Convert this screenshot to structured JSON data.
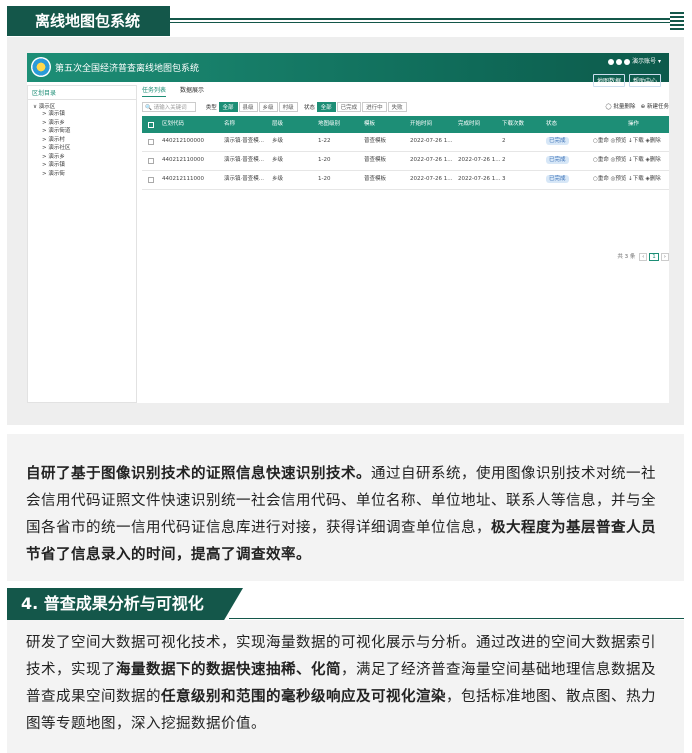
{
  "section1": {
    "title": "离线地图包系统"
  },
  "app": {
    "title": "第五次全国经济普查离线地图包系统",
    "user": "演示账号",
    "buttons": [
      "地图数据",
      "帮助中心"
    ],
    "sidebar": {
      "title": "区划目录",
      "root": "演示区",
      "items": [
        "演示镇",
        "演示乡",
        "演示街道",
        "演示村",
        "演示社区",
        "演示乡",
        "演示镇",
        "演示街"
      ]
    },
    "tabs": [
      "任务列表",
      "数据展示"
    ],
    "filters": {
      "search_placeholder": "请输入关键词",
      "type_label": "类型",
      "type_options": [
        "全部",
        "县级",
        "乡级",
        "村级"
      ],
      "status_label": "状态",
      "status_options": [
        "全部",
        "已完成",
        "进行中",
        "失败"
      ],
      "right1": "批量删除",
      "right2": "新建任务"
    },
    "table": {
      "headers": [
        "区划代码",
        "名称",
        "层级",
        "地图级别",
        "模板",
        "开始时间",
        "完成时间",
        "下载次数",
        "状态",
        "操作"
      ],
      "rows": [
        {
          "code": "440212100000",
          "name": "演示镇·普查模...",
          "level": "乡级",
          "zoom": "1-22",
          "template": "普查模板",
          "start": "2022-07-26 1...",
          "end": "",
          "count": "2",
          "status": "已完成",
          "ops": [
            "重命",
            "预览",
            "下载",
            "删除"
          ]
        },
        {
          "code": "440212110000",
          "name": "演示镇·普查模...",
          "level": "乡级",
          "zoom": "1-20",
          "template": "普查模板",
          "start": "2022-07-26 1...",
          "end": "2022-07-26 1...",
          "count": "2",
          "status": "已完成",
          "ops": [
            "重命",
            "预览",
            "下载",
            "删除"
          ]
        },
        {
          "code": "440212111000",
          "name": "演示镇·普查模...",
          "level": "乡级",
          "zoom": "1-20",
          "template": "普查模板",
          "start": "2022-07-26 1...",
          "end": "2022-07-26 1...",
          "count": "3",
          "status": "已完成",
          "ops": [
            "重命",
            "预览",
            "下载",
            "删除"
          ]
        }
      ]
    },
    "pager": {
      "total": "共 3 条",
      "page": "1"
    }
  },
  "para1": {
    "s1": "自研了基于图像识别技术的证照信息快速识别技术。",
    "s2": "通过自研系统，使用图像识别技术对统一社会信用代码证照文件快速识别统一社会信用代码、单位名称、单位地址、联系人等信息，并与全国各省市的统一信用代码证信息库进行对接，获得详细调查单位信息，",
    "s3": "极大程度为基层普查人员节省了信息录入的时间，提高了调查效率。"
  },
  "section2": {
    "title": "4. 普查成果分析与可视化"
  },
  "para2": {
    "s1": "研发了空间大数据可视化技术，实现海量数据的可视化展示与分析。通过改进的空间大数据索引技术，实现了",
    "s2": "海量数据下的数据快速抽稀、化简",
    "s3": "，满足了经济普查海量空间基础地理信息数据及普查成果空间数据的",
    "s4": "任意级别和范围的毫秒级响应及可视化渲染",
    "s5": "，包括标准地图、散点图、热力图等专题地图，深入挖掘数据价值。"
  }
}
